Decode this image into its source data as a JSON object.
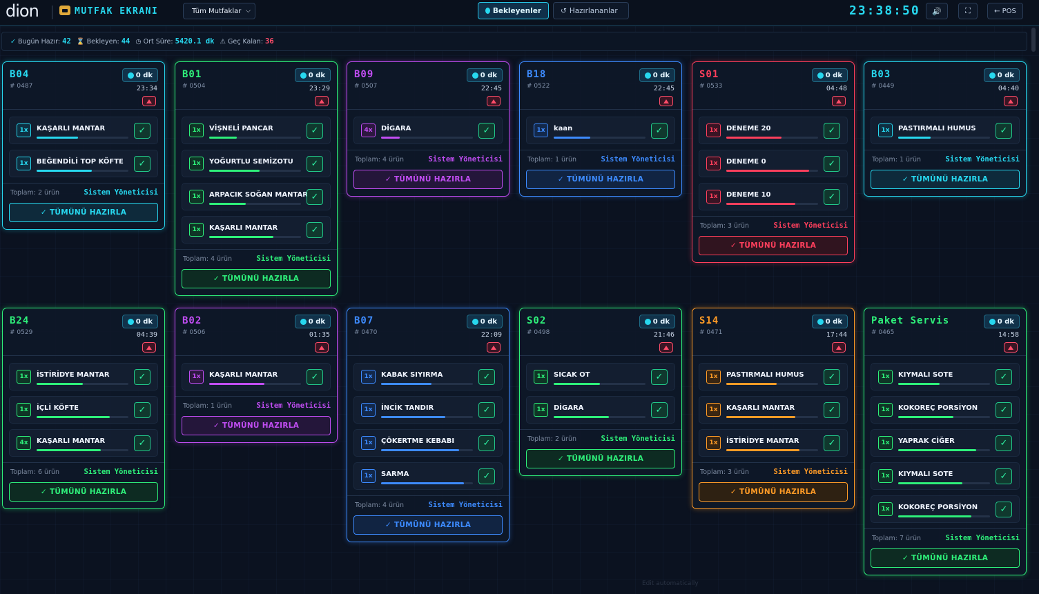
{
  "header": {
    "logo_text": "dion",
    "title": "MUTFAK EKRANI",
    "kitchen_select": "Tüm Mutfaklar",
    "tab_pending": "Bekleyenler",
    "tab_prepared": "Hazırlananlar",
    "clock": "23:38:50",
    "pos_label": "POS"
  },
  "stats": {
    "ready_label": "Bugün Hazır:",
    "ready_value": "42",
    "waiting_label": "Bekleyen:",
    "waiting_value": "44",
    "avg_label": "Ort Süre:",
    "avg_value": "5420.1 dk",
    "late_label": "Geç Kalan:",
    "late_value": "36"
  },
  "common": {
    "minutes_label": "0 dk",
    "manager": "Sistem Yöneticisi",
    "prepare_all": "TÜMÜNÜ HAZIRLA"
  },
  "colors": {
    "cyan": "#27d8ef",
    "green": "#2ef07a",
    "purple": "#c14df3",
    "blue": "#3d8bff",
    "red": "#ff3f5c",
    "orange": "#ff9b26"
  },
  "orders": [
    {
      "title": "B04",
      "no": "# 0487",
      "time": "23:34",
      "total": "Toplam: 2 ürün",
      "color": "cyan",
      "items": [
        {
          "qty": "1x",
          "name": "KAŞARLI MANTAR",
          "progress": 0.45
        },
        {
          "qty": "1x",
          "name": "BEĞENDİLİ TOP KÖFTE",
          "progress": 0.6
        }
      ]
    },
    {
      "title": "B01",
      "no": "# 0504",
      "time": "23:29",
      "total": "Toplam: 4 ürün",
      "color": "green",
      "items": [
        {
          "qty": "1x",
          "name": "VİŞNELİ PANCAR",
          "progress": 0.3
        },
        {
          "qty": "1x",
          "name": "YOĞURTLU SEMİZOTU",
          "progress": 0.55
        },
        {
          "qty": "1x",
          "name": "ARPACIK SOĞAN MANTAR",
          "progress": 0.4
        },
        {
          "qty": "1x",
          "name": "KAŞARLI MANTAR",
          "progress": 0.7
        }
      ]
    },
    {
      "title": "B09",
      "no": "# 0507",
      "time": "22:45",
      "total": "Toplam: 4 ürün",
      "color": "purple",
      "items": [
        {
          "qty": "4x",
          "name": "DİGARA",
          "progress": 0.2
        }
      ]
    },
    {
      "title": "B18",
      "no": "# 0522",
      "time": "22:45",
      "total": "Toplam: 1 ürün",
      "color": "blue",
      "items": [
        {
          "qty": "1x",
          "name": "kaan",
          "progress": 0.4
        }
      ]
    },
    {
      "title": "S01",
      "no": "# 0533",
      "time": "04:48",
      "total": "Toplam: 3 ürün",
      "color": "red",
      "items": [
        {
          "qty": "1x",
          "name": "DENEME 20",
          "progress": 0.6
        },
        {
          "qty": "1x",
          "name": "DENEME 0",
          "progress": 0.9
        },
        {
          "qty": "1x",
          "name": "DENEME 10",
          "progress": 0.75
        }
      ]
    },
    {
      "title": "B03",
      "no": "# 0449",
      "time": "04:40",
      "total": "Toplam: 1 ürün",
      "color": "cyan",
      "items": [
        {
          "qty": "1x",
          "name": "PASTIRMALI HUMUS",
          "progress": 0.35
        }
      ]
    },
    {
      "title": "B24",
      "no": "# 0529",
      "time": "04:39",
      "total": "Toplam: 6 ürün",
      "color": "green",
      "items": [
        {
          "qty": "1x",
          "name": "İSTİRİDYE MANTAR",
          "progress": 0.5
        },
        {
          "qty": "1x",
          "name": "İÇLİ KÖFTE",
          "progress": 0.8
        },
        {
          "qty": "4x",
          "name": "KAŞARLI MANTAR",
          "progress": 0.7
        }
      ]
    },
    {
      "title": "B02",
      "no": "# 0506",
      "time": "01:35",
      "total": "Toplam: 1 ürün",
      "color": "purple",
      "items": [
        {
          "qty": "1x",
          "name": "KAŞARLI MANTAR",
          "progress": 0.6
        }
      ]
    },
    {
      "title": "B07",
      "no": "# 0470",
      "time": "22:09",
      "total": "Toplam: 4 ürün",
      "color": "blue",
      "items": [
        {
          "qty": "1x",
          "name": "KABAK SIYIRMA",
          "progress": 0.55
        },
        {
          "qty": "1x",
          "name": "İNCİK TANDIR",
          "progress": 0.7
        },
        {
          "qty": "1x",
          "name": "ÇÖKERTME KEBABI",
          "progress": 0.85
        },
        {
          "qty": "1x",
          "name": "SARMA",
          "progress": 0.9
        }
      ]
    },
    {
      "title": "S02",
      "no": "# 0498",
      "time": "21:46",
      "total": "Toplam: 2 ürün",
      "color": "green",
      "items": [
        {
          "qty": "1x",
          "name": "SICAK OT",
          "progress": 0.5
        },
        {
          "qty": "1x",
          "name": "DİGARA",
          "progress": 0.6
        }
      ]
    },
    {
      "title": "S14",
      "no": "# 0471",
      "time": "17:44",
      "total": "Toplam: 3 ürün",
      "color": "orange",
      "items": [
        {
          "qty": "1x",
          "name": "PASTIRMALI HUMUS",
          "progress": 0.55
        },
        {
          "qty": "1x",
          "name": "KAŞARLI MANTAR",
          "progress": 0.75
        },
        {
          "qty": "1x",
          "name": "İSTİRİDYE MANTAR",
          "progress": 0.8
        }
      ]
    },
    {
      "title": "Paket Servis",
      "no": "# 0465",
      "time": "14:58",
      "total": "Toplam: 7 ürün",
      "color": "green",
      "items": [
        {
          "qty": "1x",
          "name": "KIYMALI SOTE",
          "progress": 0.45
        },
        {
          "qty": "1x",
          "name": "KOKOREÇ PORSİYON",
          "progress": 0.6
        },
        {
          "qty": "1x",
          "name": "YAPRAK CİĞER",
          "progress": 0.85
        },
        {
          "qty": "1x",
          "name": "KIYMALI SOTE",
          "progress": 0.7
        },
        {
          "qty": "1x",
          "name": "KOKOREÇ PORSİYON",
          "progress": 0.8
        }
      ]
    }
  ],
  "footer_ghost": "Edit automatically"
}
